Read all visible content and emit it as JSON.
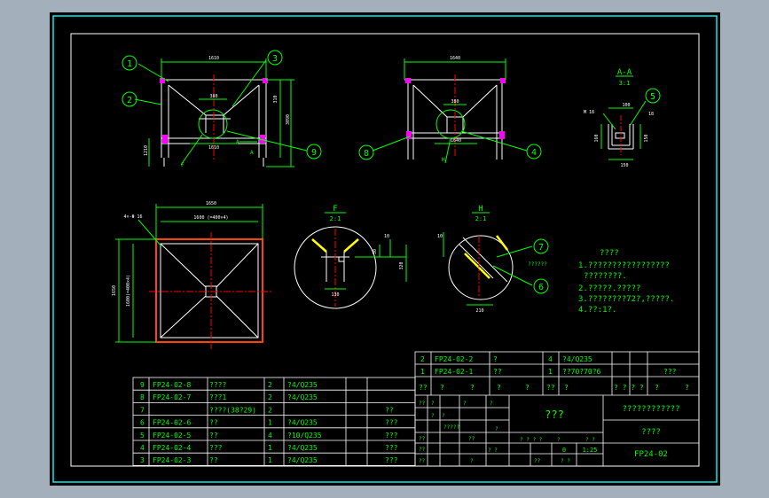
{
  "colors": {
    "background": "#a3b0bc",
    "sheet": "#000000",
    "border": "#ffffff",
    "frame_outer": "#00ffff",
    "part": "#ffffff",
    "dimension": "#00ff00",
    "centerline": "#ff0000",
    "frame_beam": "#ff00ff",
    "hidden": "#ffff00",
    "balloon": "#00ff00",
    "text": "#00ff00",
    "title_text": "#00ff00"
  },
  "views": {
    "front": {
      "balloons": [
        "1",
        "2",
        "3",
        "9"
      ],
      "dims": {
        "top": "1610",
        "height": "3090",
        "height_small": "310",
        "mid_w": "380",
        "bottom_w": "1610",
        "leg": "1210",
        "side_a": "A",
        "side_a_full": "A",
        "detail": "F"
      }
    },
    "side": {
      "balloons": [
        "8",
        "4"
      ],
      "dims": {
        "top": "1640",
        "mid": "380",
        "bottom": "1640",
        "detail": "H"
      }
    },
    "section_aa": {
      "title": "A-A",
      "scale": "3:1",
      "balloon": "5",
      "dims": {
        "w1": "100",
        "w2": "10",
        "w3": "18",
        "h1": "160",
        "h2": "150",
        "b": "150",
        "t": "M 18"
      }
    },
    "plan": {
      "dims": {
        "top1": "1650",
        "top2": "1600 (=400×4)",
        "left1": "1650",
        "left2": "1600(=400×4)",
        "note": "4×-Φ 16"
      }
    },
    "detail_f": {
      "title": "F",
      "scale": "2:1",
      "dims": {
        "a": "10",
        "b": "30",
        "c": "130",
        "d": "320"
      }
    },
    "detail_h": {
      "title": "H",
      "scale": "2:1",
      "balloons": [
        "7",
        "6"
      ],
      "dims": {
        "a": "10",
        "b": "210"
      },
      "note": "??????"
    }
  },
  "notes": {
    "heading": "????",
    "lines": [
      "1.?????????????????",
      "????????.",
      "2.?????.?????",
      "3.????????72?,?????.",
      "4.??:1?."
    ]
  },
  "bom": [
    {
      "no": "9",
      "code": "FP24-02-8",
      "name": "????",
      "qty": "2",
      "mat": "?4/Q235",
      "note": ""
    },
    {
      "no": "8",
      "code": "FP24-02-7",
      "name": "???1",
      "qty": "2",
      "mat": "?4/Q235",
      "note": ""
    },
    {
      "no": "7",
      "code": "",
      "name": "????(38?29)",
      "qty": "2",
      "mat": "",
      "note": "??"
    },
    {
      "no": "6",
      "code": "FP24-02-6",
      "name": "??",
      "qty": "1",
      "mat": "?4/Q235",
      "note": "???"
    },
    {
      "no": "5",
      "code": "FP24-02-5",
      "name": "??",
      "qty": "4",
      "mat": "?10/Q235",
      "note": "???"
    },
    {
      "no": "4",
      "code": "FP24-02-4",
      "name": "???",
      "qty": "1",
      "mat": "?4/Q235",
      "note": "???"
    },
    {
      "no": "3",
      "code": "FP24-02-3",
      "name": "??",
      "qty": "1",
      "mat": "?4/Q235",
      "note": "???"
    }
  ],
  "bom_upper": [
    {
      "no": "2",
      "code": "FP24-02-2",
      "name": "?",
      "qty": "4",
      "mat": "?4/Q235",
      "note": ""
    },
    {
      "no": "1",
      "code": "FP24-02-1",
      "name": "??",
      "qty": "1",
      "mat": "??70?70?6",
      "note": "???"
    }
  ],
  "bom_header": [
    "??",
    "?",
    "?",
    "?",
    "?",
    "??",
    "?",
    "? ?\n? ?",
    "?",
    "?"
  ],
  "title_block": {
    "title": "???",
    "company": "????????????",
    "unit": "????",
    "drawing_no": "FP24-02",
    "scale": "1:25",
    "sheet": "0",
    "cells": [
      "??",
      "?",
      "?????",
      "??",
      "??",
      "??",
      "??",
      "?",
      "?",
      "?",
      "?",
      "?",
      "?",
      "? ? ? ?",
      "?",
      "??",
      "? ?",
      "? ?",
      "? ?"
    ]
  }
}
